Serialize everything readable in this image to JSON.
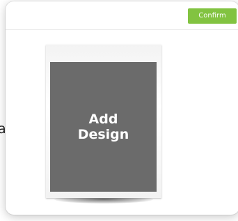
{
  "background": {
    "text_fragment": "ay"
  },
  "modal": {
    "confirm_label": "Confirm",
    "design_placeholder": "Add\nDesign"
  },
  "colors": {
    "confirm_button": "#82c341",
    "design_area": "#6b6b6b"
  }
}
